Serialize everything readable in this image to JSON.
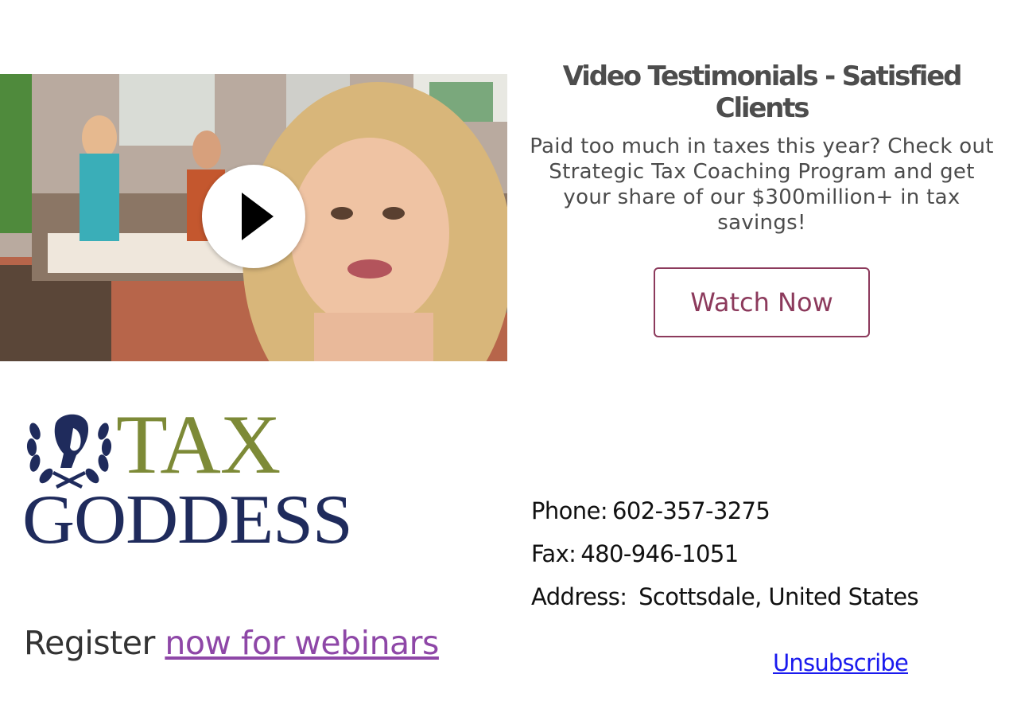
{
  "video": {
    "thumbnail_icon": "video-thumbnail",
    "play_icon": "play-icon"
  },
  "section": {
    "heading": "Video Testimonials - Satisfied Clients",
    "intro": "Paid too much in taxes this year? Check out Strategic Tax Coaching Program and get your share of our $300million+ in tax savings!",
    "watch_button": "Watch Now"
  },
  "logo": {
    "word_top": "TAX",
    "word_bottom": "GODDESS",
    "emblem_icon": "goddess-emblem-icon"
  },
  "register": {
    "prefix": "Register",
    "link": "now for webinars"
  },
  "contact": {
    "phone_label": "Phone:",
    "phone": "602-357-3275",
    "fax_label": "Fax:",
    "fax": "480-946-1051",
    "address_label": "Address:",
    "address_city": "Scottsdale,",
    "address_country": "United States"
  },
  "footer": {
    "unsubscribe": "Unsubscribe"
  },
  "colors": {
    "accent": "#8c3a5c",
    "link_purple": "#8e47a7",
    "link_blue": "#1a1aee",
    "logo_olive": "#7d8a37",
    "logo_navy": "#1f2b5c"
  }
}
